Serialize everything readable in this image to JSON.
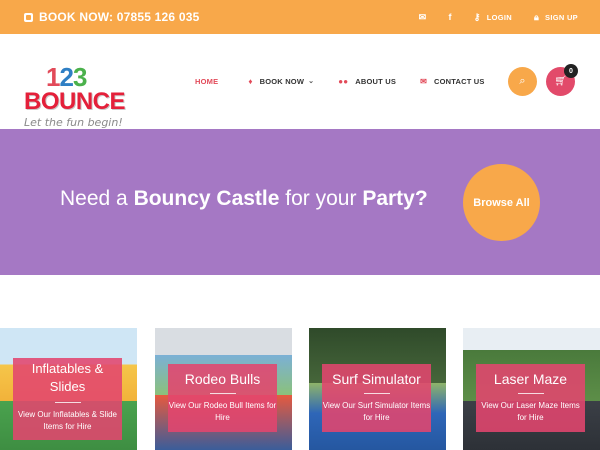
{
  "topbar": {
    "phone_label": "BOOK NOW: 07855 126 035",
    "email_icon": "envelope-icon",
    "facebook_icon": "facebook-icon",
    "login_label": "LOGIN",
    "signup_label": "SIGN UP"
  },
  "logo": {
    "num1": "1",
    "num2": "2",
    "num3": "3",
    "word": "BOUNCE",
    "tagline": "Let the fun begin!"
  },
  "nav": {
    "home": "HOME",
    "book_now": "BOOK NOW",
    "about_us": "ABOUT US",
    "contact_us": "CONTACT US"
  },
  "cart": {
    "count": "0"
  },
  "hero": {
    "headline_part1": "Need a ",
    "headline_bold1": "Bouncy Castle",
    "headline_part2": " for your ",
    "headline_bold2": "Party?",
    "browse_label": "Browse All"
  },
  "cards": [
    {
      "title": "Inflatables & Slides",
      "desc": "View Our Inflatables & Slide Items for Hire"
    },
    {
      "title": "Rodeo Bulls",
      "desc": "View Our Rodeo Bull Items for Hire"
    },
    {
      "title": "Surf Simulator",
      "desc": "View Our Surf Simulator Items for Hire"
    },
    {
      "title": "Laser Maze",
      "desc": "View Our Laser Maze Items for Hire"
    }
  ],
  "colors": {
    "topbar": "#f8a84a",
    "hero": "#a578c4",
    "accent_pink": "#e24a6a",
    "accent_orange": "#f8a84a"
  }
}
